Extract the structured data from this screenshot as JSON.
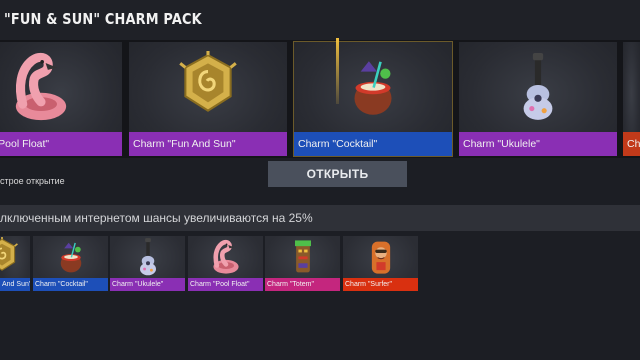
{
  "header": {
    "title": "\"FUN & SUN\" CHARM PACK"
  },
  "carousel": {
    "items": [
      {
        "label": "Charm \"Pool Float\"",
        "icon": "flamingo-float-icon",
        "color": "#8a2fb4"
      },
      {
        "label": "Charm \"Fun And Sun\"",
        "icon": "sun-badge-icon",
        "color": "#8a2fb4"
      },
      {
        "label": "Charm \"Cocktail\"",
        "icon": "coconut-cocktail-icon",
        "color": "#1d4fb8"
      },
      {
        "label": "Charm \"Ukulele\"",
        "icon": "ukulele-icon",
        "color": "#8a2fb4"
      },
      {
        "label": "Cha",
        "icon": "",
        "color": "#c23a1a"
      }
    ]
  },
  "quick_open": {
    "label": "строе открытие"
  },
  "open_button": {
    "label": "ОТКРЫТЬ"
  },
  "info": {
    "text": "лключенным интернетом шансы увеличиваются на 25%"
  },
  "contents": {
    "items": [
      {
        "label": "And Sun\"",
        "icon": "sun-badge-icon",
        "color": "#1d4fb8"
      },
      {
        "label": "Charm \"Cocktail\"",
        "icon": "coconut-cocktail-icon",
        "color": "#1d4fb8"
      },
      {
        "label": "Charm \"Ukulele\"",
        "icon": "ukulele-icon",
        "color": "#8a2fb4"
      },
      {
        "label": "Charm \"Pool Float\"",
        "icon": "flamingo-float-icon",
        "color": "#8a2fb4"
      },
      {
        "label": "Charm \"Totem\"",
        "icon": "totem-icon",
        "color": "#c4267e"
      },
      {
        "label": "Charm \"Surfer\"",
        "icon": "surfer-icon",
        "color": "#d93010"
      }
    ]
  }
}
